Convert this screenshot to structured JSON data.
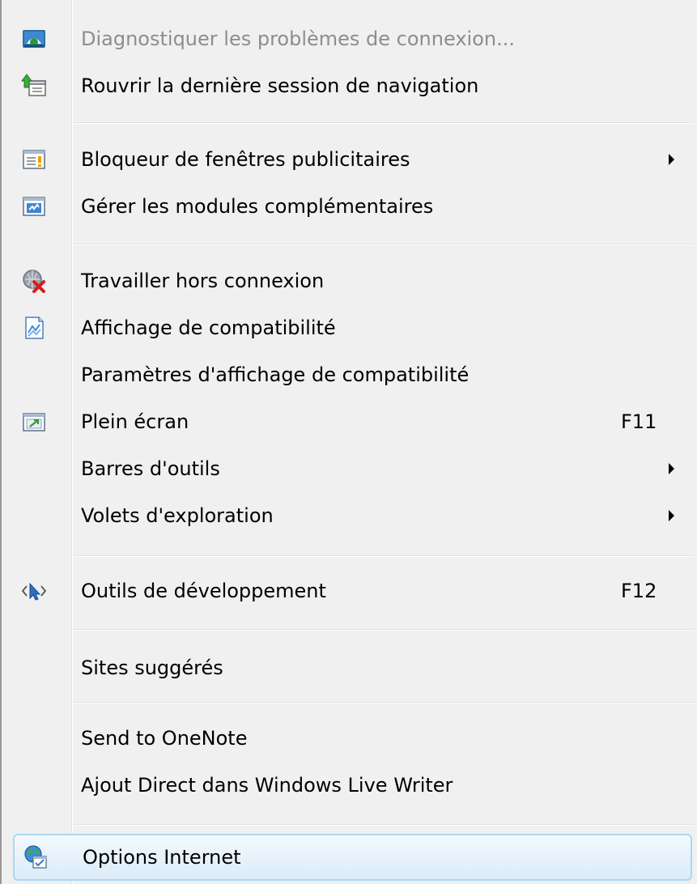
{
  "menu": {
    "items": [
      {
        "label": "Diagnostiquer les problèmes de connexion...",
        "icon": "network-diagnostic-icon",
        "disabled": true
      },
      {
        "label": "Rouvrir la dernière session de navigation",
        "icon": "reopen-session-icon"
      },
      {
        "label": "Bloqueur de fenêtres publicitaires",
        "icon": "popup-blocker-icon",
        "submenu": true
      },
      {
        "label": "Gérer les modules complémentaires",
        "icon": "manage-addons-icon"
      },
      {
        "label": "Travailler hors connexion",
        "icon": "work-offline-icon"
      },
      {
        "label": "Affichage de compatibilité",
        "icon": "compatibility-view-icon"
      },
      {
        "label": "Paramètres d'affichage de compatibilité"
      },
      {
        "label": "Plein écran",
        "icon": "full-screen-icon",
        "shortcut": "F11"
      },
      {
        "label": "Barres d'outils",
        "submenu": true
      },
      {
        "label": "Volets d'exploration",
        "submenu": true
      },
      {
        "label": "Outils de développement",
        "icon": "developer-tools-icon",
        "shortcut": "F12"
      },
      {
        "label": "Sites suggérés"
      },
      {
        "label": "Send to OneNote"
      },
      {
        "label": "Ajout Direct dans Windows Live Writer"
      },
      {
        "label": "Options Internet",
        "icon": "internet-options-icon",
        "highlighted": true
      }
    ]
  },
  "colors": {
    "menu_background": "#f0f0f0",
    "disabled_text": "#8d8d8d",
    "highlight_border": "#a8d8f6",
    "highlight_fill": "#e7f2fb"
  }
}
